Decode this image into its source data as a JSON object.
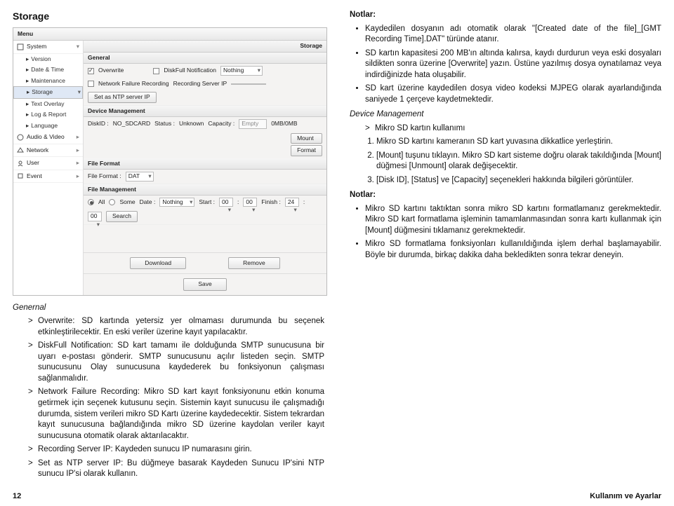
{
  "page_number": "12",
  "footer_right": "Kullanım ve Ayarlar",
  "left": {
    "title": "Storage",
    "shot": {
      "menu": "Menu",
      "storageTab": "Storage",
      "side_groups": {
        "system": "System",
        "version": "Version",
        "datetime": "Date & Time",
        "maintenance": "Maintenance",
        "storage": "Storage",
        "textoverlay": "Text Overlay",
        "logreport": "Log & Report",
        "language": "Language",
        "audiovideo": "Audio & Video",
        "network": "Network",
        "user": "User",
        "event": "Event"
      },
      "general_head": "General",
      "overwrite": "Overwrite",
      "diskfull": "DiskFull Notification",
      "nothing": "Nothing",
      "netfail": "Network Failure Recording",
      "recserver": "Recording Server IP",
      "ntpbtn": "Set as NTP server IP",
      "dev_head": "Device Management",
      "diskid_lbl": "DiskID :",
      "diskid_val": "NO_SDCARD",
      "status_lbl": "Status :",
      "status_val": "Unknown",
      "capacity_lbl": "Capacity :",
      "capacity_val": "Empty",
      "capacity_unit": "0MB/0MB",
      "mount": "Mount",
      "format": "Format",
      "fileformat_head": "File Format",
      "fileformat_lbl": "File Format :",
      "fileformat_val": "DAT",
      "filemgmt_head": "File Management",
      "all": "All",
      "some": "Some",
      "date": "Date :",
      "start": "Start :",
      "finish": "Finish :",
      "h00": "00",
      "h24": "24",
      "search": "Search",
      "download": "Download",
      "remove": "Remove",
      "save": "Save"
    },
    "genernal": "Genernal",
    "items": [
      "Overwrite: SD kartında yetersiz yer olmaması durumunda bu seçenek etkinleştirilecektir. En eski veriler üzerine kayıt yapılacaktır.",
      "DiskFull Notification: SD kart tamamı ile dolduğunda SMTP sunucusuna bir uyarı e-postası gönderir. SMTP sunucusunu açılır listeden seçin. SMTP sunucusunu Olay sunucusuna kaydederek bu fonksiyonun çalışması sağlanmalıdır.",
      "Network Failure Recording: Mikro SD kart kayıt fonksiyonunu etkin konuma getirmek için seçenek kutusunu seçin. Sistemin kayıt sunucusu ile çalışmadığı durumda, sistem verileri mikro SD Kartı üzerine kaydedecektir. Sistem tekrardan kayıt sunucusuna bağlandığında mikro SD üzerine kaydolan veriler kayıt sunucusuna otomatik olarak aktarılacaktır.",
      "Recording Server IP: Kaydeden sunucu IP numarasını girin.",
      "Set as NTP server IP: Bu düğmeye basarak Kaydeden Sunucu IP'sini NTP sunucu IP'si olarak kullanın."
    ]
  },
  "right": {
    "notes1_title": "Notlar:",
    "notes1": [
      "Kaydedilen dosyanın adı otomatik olarak \"[Created date of the file]_[GMT Recording Time].DAT\" türünde atanır.",
      "SD kartın kapasitesi 200 MB'ın altında kalırsa, kaydı durdurun veya eski dosyaları sildikten sonra üzerine [Overwrite] yazın. Üstüne yazılmış dosya oynatılamaz veya indirdiğinizde hata oluşabilir.",
      "SD kart üzerine kaydedilen dosya video kodeksi MJPEG olarak ayarlandığında saniyede 1 çerçeve kaydetmektedir."
    ],
    "devmgmt": "Device Management",
    "sd_item": "Mikro SD kartın kullanımı",
    "numlist": [
      "Mikro SD kartını kameranın SD kart yuvasına dikkatlice yerleştirin.",
      "[Mount] tuşunu tıklayın. Mikro SD kart sisteme doğru olarak takıldığında [Mount] düğmesi [Unmount] olarak değişecektir.",
      "[Disk ID], [Status] ve [Capacity] seçenekleri hakkında bilgileri görüntüler."
    ],
    "notes2_title": "Notlar:",
    "notes2": [
      "Mikro SD kartını taktıktan sonra mikro SD kartını formatlamanız gerekmektedir. Mikro SD kart formatlama işleminin tamamlanmasından sonra kartı kullanmak için [Mount] düğmesini tıklamanız gerekmektedir.",
      "Mikro SD formatlama fonksiyonları kullanıldığında işlem derhal başlamayabilir. Böyle bir durumda, birkaç dakika daha bekledikten sonra tekrar deneyin."
    ]
  }
}
